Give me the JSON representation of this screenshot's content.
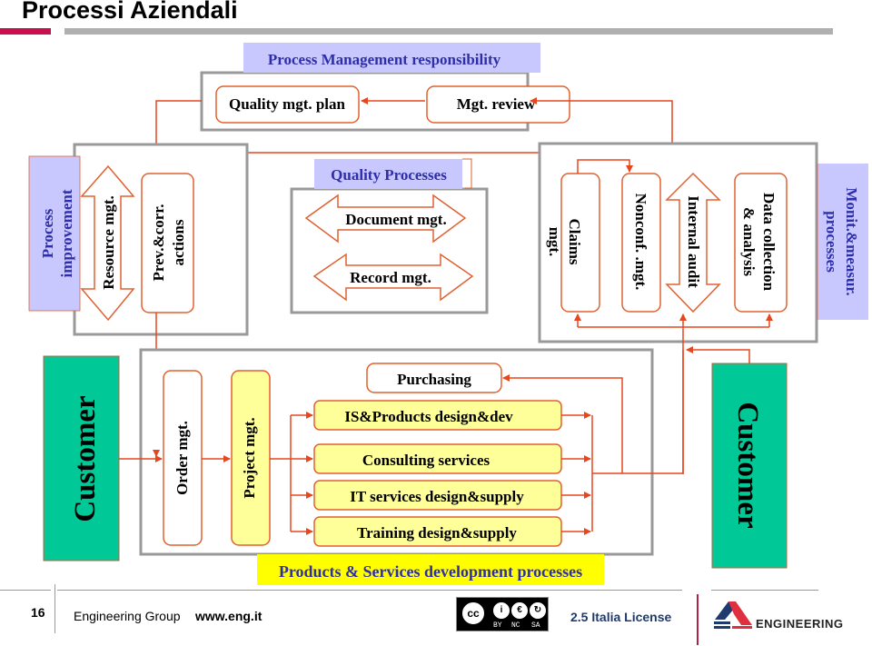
{
  "slide": {
    "title": "Processi Aziendali",
    "page_number": "16",
    "company": "Engineering Group",
    "url": "www.eng.it",
    "license_text": "2.5 Italia License",
    "license_badge": {
      "main": "cc",
      "bottom_labels": [
        "BY",
        "NC",
        "SA"
      ]
    },
    "brand_logo_text": "ENGINEERING"
  },
  "colors": {
    "title_bar_accent": "#c8104e",
    "connector": "#e8461e",
    "box_border": "#999999",
    "lavender_label": "#c8c8ff",
    "label_text_blue": "#2e2ea8",
    "customer_green": "#00c896",
    "yellow_box": "#ffff99",
    "yellow_banner": "#ffff00"
  },
  "diagram": {
    "management": {
      "header": "Process Management responsibility",
      "items": [
        "Quality mgt. plan",
        "Mgt. review"
      ]
    },
    "improvement": {
      "side_label": "Process improvement",
      "side_label_lines": [
        "Process",
        "improvement"
      ],
      "items": [
        {
          "label": "Resource mgt.",
          "shape": "double-arrow"
        },
        {
          "label_lines": [
            "Prev.&corr.",
            "actions"
          ],
          "shape": "rounded-box"
        }
      ]
    },
    "quality": {
      "header": "Quality Processes",
      "items": [
        "Document mgt.",
        "Record mgt."
      ]
    },
    "monitoring": {
      "side_label_lines": [
        "Monit.&measur.",
        "processes"
      ],
      "items": [
        {
          "label_lines": [
            "Claims",
            "mgt."
          ],
          "shape": "rounded-box"
        },
        {
          "label": "Nonconf. .mgt.",
          "shape": "rounded-box"
        },
        {
          "label": "Internal audit",
          "shape": "double-arrow"
        },
        {
          "label_lines": [
            "Data collection",
            "& analysis"
          ],
          "shape": "rounded-box"
        }
      ]
    },
    "development": {
      "footer": "Products & Services development processes",
      "customer_in": "Customer",
      "customer_out": "Customer",
      "order": "Order mgt.",
      "project": "Project mgt.",
      "purchasing": "Purchasing",
      "services": [
        "IS&Products design&dev",
        "Consulting services",
        "IT services design&supply",
        "Training design&supply"
      ]
    }
  }
}
